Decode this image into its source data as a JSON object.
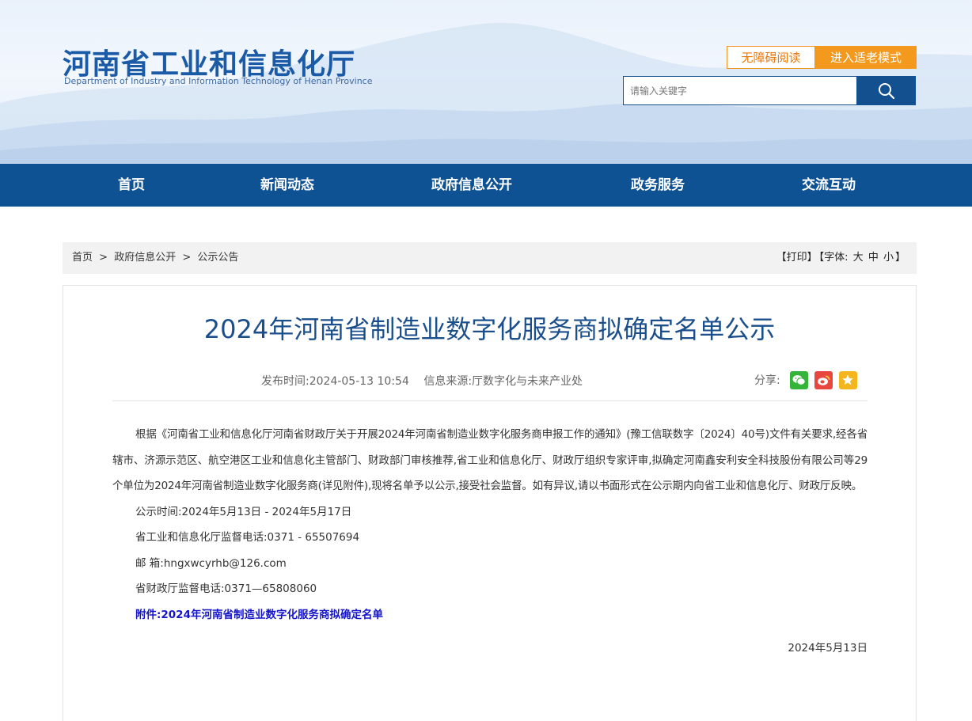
{
  "header": {
    "logo_cn": "河南省工业和信息化厅",
    "logo_en": "Department of Industry and Information Technology of Henan Province",
    "accessible_label": "无障碍阅读",
    "elder_mode_label": "进入适老模式",
    "search_placeholder": "请输入关键字",
    "search_icon": "search-icon"
  },
  "nav": {
    "items": [
      "首页",
      "新闻动态",
      "政府信息公开",
      "政务服务",
      "交流互动"
    ]
  },
  "breadcrumb": {
    "items": [
      "首页",
      ">",
      "政府信息公开",
      ">",
      "公示公告"
    ]
  },
  "tools": {
    "print": "【打印】",
    "font_prefix": "【字体:",
    "font_large": "大",
    "font_medium": "中",
    "font_small": "小",
    "font_suffix": "】"
  },
  "article": {
    "title": "2024年河南省制造业数字化服务商拟确定名单公示",
    "publish_time": "发布时间:2024-05-13 10:54",
    "source": "信息来源:厅数字化与未来产业处",
    "share_label": "分享:",
    "share_icons": [
      "wechat-icon",
      "weibo-icon",
      "favorite-icon"
    ],
    "paragraph": "根据《河南省工业和信息化厅河南省财政厅关于开展2024年河南省制造业数字化服务商申报工作的通知》(豫工信联数字〔2024〕40号)文件有关要求,经各省辖市、济源示范区、航空港区工业和信息化主管部门、财政部门审核推荐,省工业和信息化厅、财政厅组织专家评审,拟确定河南鑫安利安全科技股份有限公司等29个单位为2024年河南省制造业数字化服务商(详见附件),现将名单予以公示,接受社会监督。如有异议,请以书面形式在公示期内向省工业和信息化厅、财政厅反映。",
    "period": "公示时间:2024年5月13日 - 2024年5月17日",
    "phone_dept": "省工业和信息化厅监督电话:0371 - 65507694",
    "email": "邮 箱:hngxwcyrhb@126.com",
    "phone_finance": "省财政厅监督电话:0371—65808060",
    "attachment": "附件:2024年河南省制造业数字化服务商拟确定名单",
    "date": "2024年5月13日"
  },
  "colors": {
    "brand_blue": "#0f5294",
    "title_blue": "#1b4f8c",
    "accent_orange": "#f39a1e",
    "link_blue": "#1515cc",
    "wechat_green": "#34b53a",
    "weibo_red": "#e8473f",
    "favorite_yellow": "#f4b51e"
  }
}
